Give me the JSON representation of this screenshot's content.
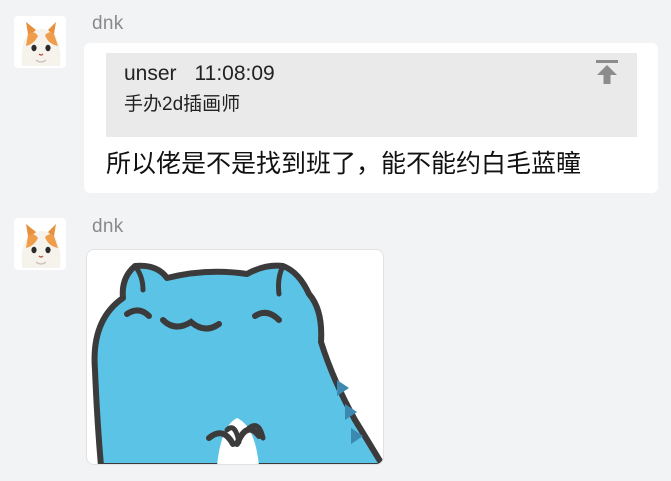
{
  "messages": [
    {
      "sender": "dnk",
      "quote": {
        "author": "unser",
        "time": "11:08:09",
        "text": "手办2d插画师"
      },
      "text": "所以佬是不是找到班了，能不能约白毛蓝瞳"
    },
    {
      "sender": "dnk",
      "sticker": "blue-dinosaur-sticker"
    }
  ],
  "colors": {
    "background": "#f2f3f5",
    "bubble": "#ffffff",
    "quote_bg": "#eaeaea",
    "sender": "#8a8a8a",
    "dino_blue": "#5bc3e6"
  }
}
